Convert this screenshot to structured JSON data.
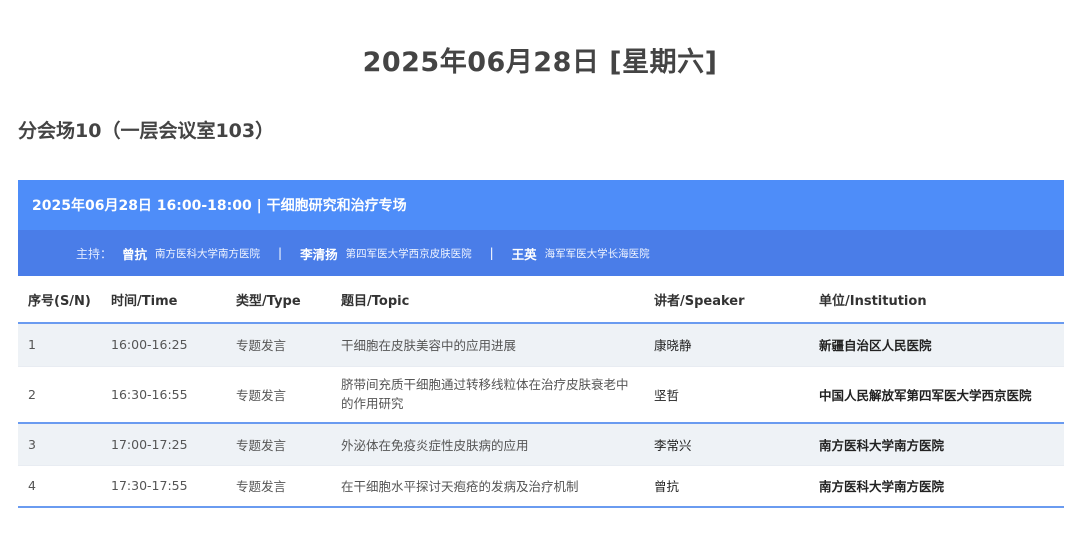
{
  "date_heading": "2025年06月28日 [星期六]",
  "venue": "分会场10（一层会议室103）",
  "session": {
    "title": "2025年06月28日 16:00-18:00 | 干细胞研究和治疗专场",
    "host_label": "主持：",
    "hosts": [
      {
        "name": "曾抗",
        "institution": "南方医科大学南方医院"
      },
      {
        "name": "李清扬",
        "institution": "第四军医大学西京皮肤医院"
      },
      {
        "name": "王英",
        "institution": "海军军医大学长海医院"
      }
    ],
    "separator": "|"
  },
  "table": {
    "headers": [
      "序号(S/N)",
      "时间/Time",
      "类型/Type",
      "题目/Topic",
      "讲者/Speaker",
      "单位/Institution"
    ],
    "rows": [
      {
        "sn": "1",
        "time": "16:00-16:25",
        "type": "专题发言",
        "topic": "干细胞在皮肤美容中的应用进展",
        "speaker": "康晓静",
        "institution": "新疆自治区人民医院"
      },
      {
        "sn": "2",
        "time": "16:30-16:55",
        "type": "专题发言",
        "topic": "脐带间充质干细胞通过转移线粒体在治疗皮肤衰老中的作用研究",
        "speaker": "坚哲",
        "institution": "中国人民解放军第四军医大学西京医院"
      },
      {
        "sn": "3",
        "time": "17:00-17:25",
        "type": "专题发言",
        "topic": "外泌体在免疫炎症性皮肤病的应用",
        "speaker": "李常兴",
        "institution": "南方医科大学南方医院"
      },
      {
        "sn": "4",
        "time": "17:30-17:55",
        "type": "专题发言",
        "topic": "在干细胞水平探讨天疱疮的发病及治疗机制",
        "speaker": "曾抗",
        "institution": "南方医科大学南方医院"
      }
    ]
  }
}
